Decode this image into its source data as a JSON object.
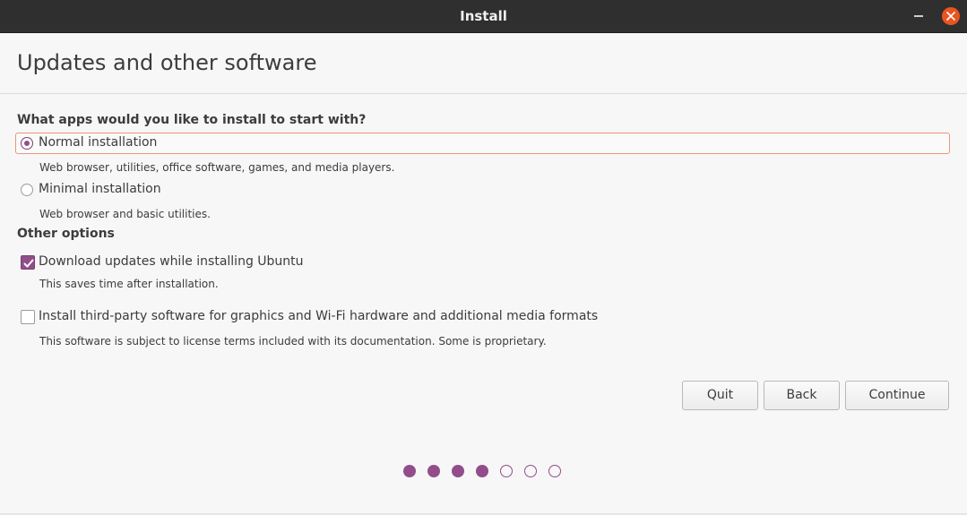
{
  "window": {
    "title": "Install",
    "accent": "#924d8b",
    "close_color": "#e95420"
  },
  "header": {
    "title": "Updates and other software"
  },
  "apps": {
    "question": "What apps would you like to install to start with?",
    "options": [
      {
        "label": "Normal installation",
        "description": "Web browser, utilities, office software, games, and media players.",
        "selected": true
      },
      {
        "label": "Minimal installation",
        "description": "Web browser and basic utilities.",
        "selected": false
      }
    ]
  },
  "other": {
    "heading": "Other options",
    "options": [
      {
        "label": "Download updates while installing Ubuntu",
        "description": "This saves time after installation.",
        "checked": true
      },
      {
        "label": "Install third-party software for graphics and Wi-Fi hardware and additional media formats",
        "description": "This software is subject to license terms included with its documentation. Some is proprietary.",
        "checked": false
      }
    ]
  },
  "buttons": {
    "quit": "Quit",
    "back": "Back",
    "continue": "Continue"
  },
  "progress": {
    "total_steps": 7,
    "completed_steps": 4
  }
}
